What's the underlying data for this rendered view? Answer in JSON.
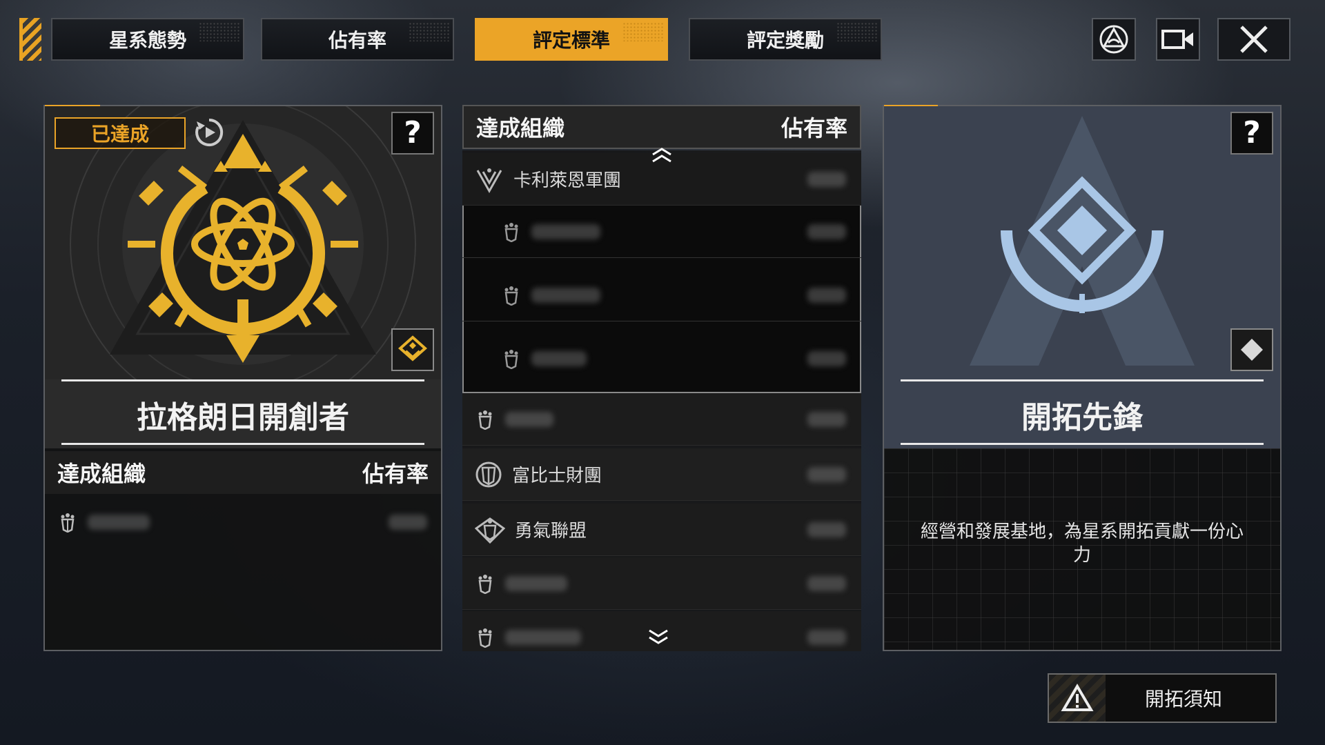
{
  "tabs": [
    {
      "label": "星系態勢",
      "active": false
    },
    {
      "label": "佔有率",
      "active": false
    },
    {
      "label": "評定標準",
      "active": true
    },
    {
      "label": "評定獎勵",
      "active": false
    }
  ],
  "controls": {
    "emblem_icon": "faction-emblem-icon",
    "video_icon": "camera-icon",
    "close_icon": "close-icon"
  },
  "left_card": {
    "status": "已達成",
    "help": "?",
    "title": "拉格朗日開創者",
    "table_header": {
      "org": "達成組織",
      "share": "佔有率"
    }
  },
  "center_list": {
    "header": {
      "org": "達成組織",
      "share": "佔有率"
    },
    "rows": [
      {
        "name": "卡利萊恩軍團",
        "icon": "calliance-icon",
        "indent": false
      },
      {
        "name": "",
        "icon": "org-shield-icon",
        "indent": true
      },
      {
        "name": "",
        "icon": "org-shield-icon",
        "indent": true
      },
      {
        "name": "",
        "icon": "org-shield-icon",
        "indent": true
      },
      {
        "name": "",
        "icon": "org-shield-icon",
        "indent": false
      },
      {
        "name": "富比士財團",
        "icon": "forbes-icon",
        "indent": false
      },
      {
        "name": "勇氣聯盟",
        "icon": "courage-icon",
        "indent": false
      },
      {
        "name": "",
        "icon": "org-shield-icon",
        "indent": false
      },
      {
        "name": "",
        "icon": "org-shield-icon",
        "indent": false
      }
    ]
  },
  "right_card": {
    "help": "?",
    "title": "開拓先鋒",
    "description": "經營和發展基地，為星系開拓貢獻一份心力"
  },
  "notice_button": {
    "label": "開拓須知",
    "icon": "warning-icon"
  },
  "colors": {
    "accent": "#eba427",
    "emblem_blue": "#a9c6e6"
  }
}
